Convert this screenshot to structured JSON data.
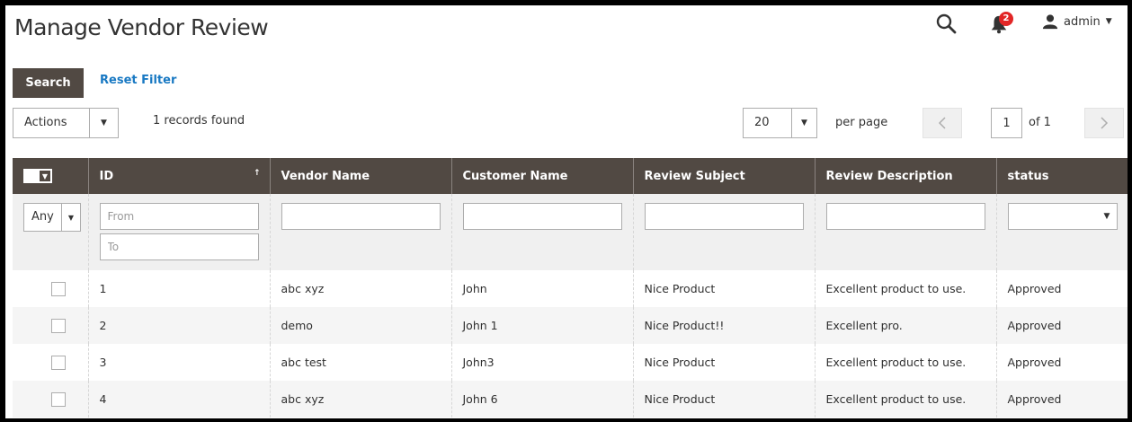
{
  "header": {
    "title": "Manage Vendor Review",
    "notification_count": "2",
    "user_name": "admin"
  },
  "toolbar": {
    "search_label": "Search",
    "reset_label": "Reset Filter",
    "actions_label": "Actions",
    "records_text": "1 records found",
    "per_page_value": "20",
    "per_page_label": "per page",
    "current_page": "1",
    "total_pages_text": "of 1"
  },
  "grid": {
    "columns": [
      "ID",
      "Vendor Name",
      "Customer Name",
      "Review Subject",
      "Review Description",
      "status"
    ],
    "filters": {
      "any_label": "Any",
      "id_from_placeholder": "From",
      "id_to_placeholder": "To"
    },
    "rows": [
      {
        "id": "1",
        "vendor": "abc xyz",
        "customer": "John",
        "subject": "Nice Product",
        "description": "Excellent product to use.",
        "status": "Approved"
      },
      {
        "id": "2",
        "vendor": "demo",
        "customer": "John 1",
        "subject": "Nice Product!!",
        "description": "Excellent pro.",
        "status": "Approved"
      },
      {
        "id": "3",
        "vendor": "abc test",
        "customer": "John3",
        "subject": "Nice Product",
        "description": "Excellent product to use.",
        "status": "Approved"
      },
      {
        "id": "4",
        "vendor": "abc xyz",
        "customer": "John 6",
        "subject": "Nice Product",
        "description": "Excellent product to use.",
        "status": "Approved"
      }
    ]
  },
  "colors": {
    "header_bg": "#514943",
    "link": "#1979c3",
    "badge": "#e22626"
  }
}
